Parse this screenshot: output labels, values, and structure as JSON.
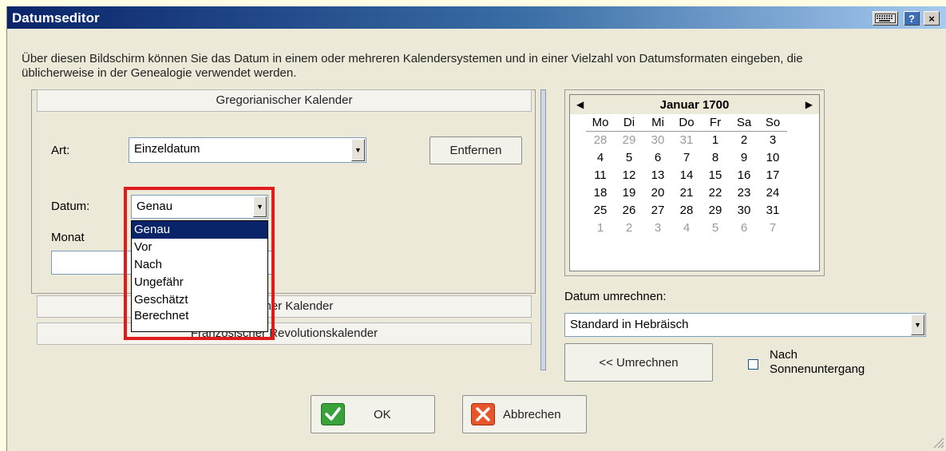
{
  "window": {
    "title": "Datumseditor"
  },
  "titlebar_buttons": {
    "keyboard": "keyboard-icon",
    "help": "?",
    "close": "×"
  },
  "description": "Über diesen Bildschirm können Sie das Datum in einem oder mehreren Kalendersystemen und in einer Vielzahl von Datumsformaten eingeben, die üblicherweise in der Genealogie verwendet werden.",
  "sections": {
    "gregorian": "Gregorianischer Kalender",
    "julian_partial": "cher Kalender",
    "french_revolution": "Französischer Revolutionskalender"
  },
  "form": {
    "art_label": "Art:",
    "art_value": "Einzeldatum",
    "remove_button": "Entfernen",
    "datum_label": "Datum:",
    "datum_value": "Genau",
    "month_label": "Monat"
  },
  "dropdown": {
    "options": [
      "Genau",
      "Vor",
      "Nach",
      "Ungefähr",
      "Geschätzt",
      "Berechnet"
    ],
    "selected": "Genau",
    "highlight_color": "#e01b1b"
  },
  "calendar": {
    "month_year": "Januar 1700",
    "prev": "◀",
    "next": "▶",
    "weekdays": [
      "Mo",
      "Di",
      "Mi",
      "Do",
      "Fr",
      "Sa",
      "So"
    ],
    "weeks": [
      [
        {
          "d": "28",
          "m": true
        },
        {
          "d": "29",
          "m": true
        },
        {
          "d": "30",
          "m": true
        },
        {
          "d": "31",
          "m": true
        },
        {
          "d": "1"
        },
        {
          "d": "2"
        },
        {
          "d": "3"
        }
      ],
      [
        {
          "d": "4"
        },
        {
          "d": "5"
        },
        {
          "d": "6"
        },
        {
          "d": "7"
        },
        {
          "d": "8"
        },
        {
          "d": "9"
        },
        {
          "d": "10"
        }
      ],
      [
        {
          "d": "11"
        },
        {
          "d": "12"
        },
        {
          "d": "13"
        },
        {
          "d": "14"
        },
        {
          "d": "15"
        },
        {
          "d": "16"
        },
        {
          "d": "17"
        }
      ],
      [
        {
          "d": "18"
        },
        {
          "d": "19"
        },
        {
          "d": "20"
        },
        {
          "d": "21"
        },
        {
          "d": "22"
        },
        {
          "d": "23"
        },
        {
          "d": "24"
        }
      ],
      [
        {
          "d": "25"
        },
        {
          "d": "26"
        },
        {
          "d": "27"
        },
        {
          "d": "28"
        },
        {
          "d": "29"
        },
        {
          "d": "30"
        },
        {
          "d": "31"
        }
      ],
      [
        {
          "d": "1",
          "m": true
        },
        {
          "d": "2",
          "m": true
        },
        {
          "d": "3",
          "m": true
        },
        {
          "d": "4",
          "m": true
        },
        {
          "d": "5",
          "m": true
        },
        {
          "d": "6",
          "m": true
        },
        {
          "d": "7",
          "m": true
        }
      ]
    ]
  },
  "convert": {
    "label": "Datum umrechnen:",
    "value": "Standard in Hebräisch",
    "button": "<< Umrechnen",
    "checkbox_label_1": "Nach",
    "checkbox_label_2": "Sonnenuntergang",
    "checked": false
  },
  "footer": {
    "ok": "OK",
    "ok_icon": "check-icon",
    "cancel": "Abbrechen",
    "cancel_icon": "x-icon",
    "ok_icon_color": "#3aa23a",
    "cancel_icon_color": "#e8552a"
  }
}
